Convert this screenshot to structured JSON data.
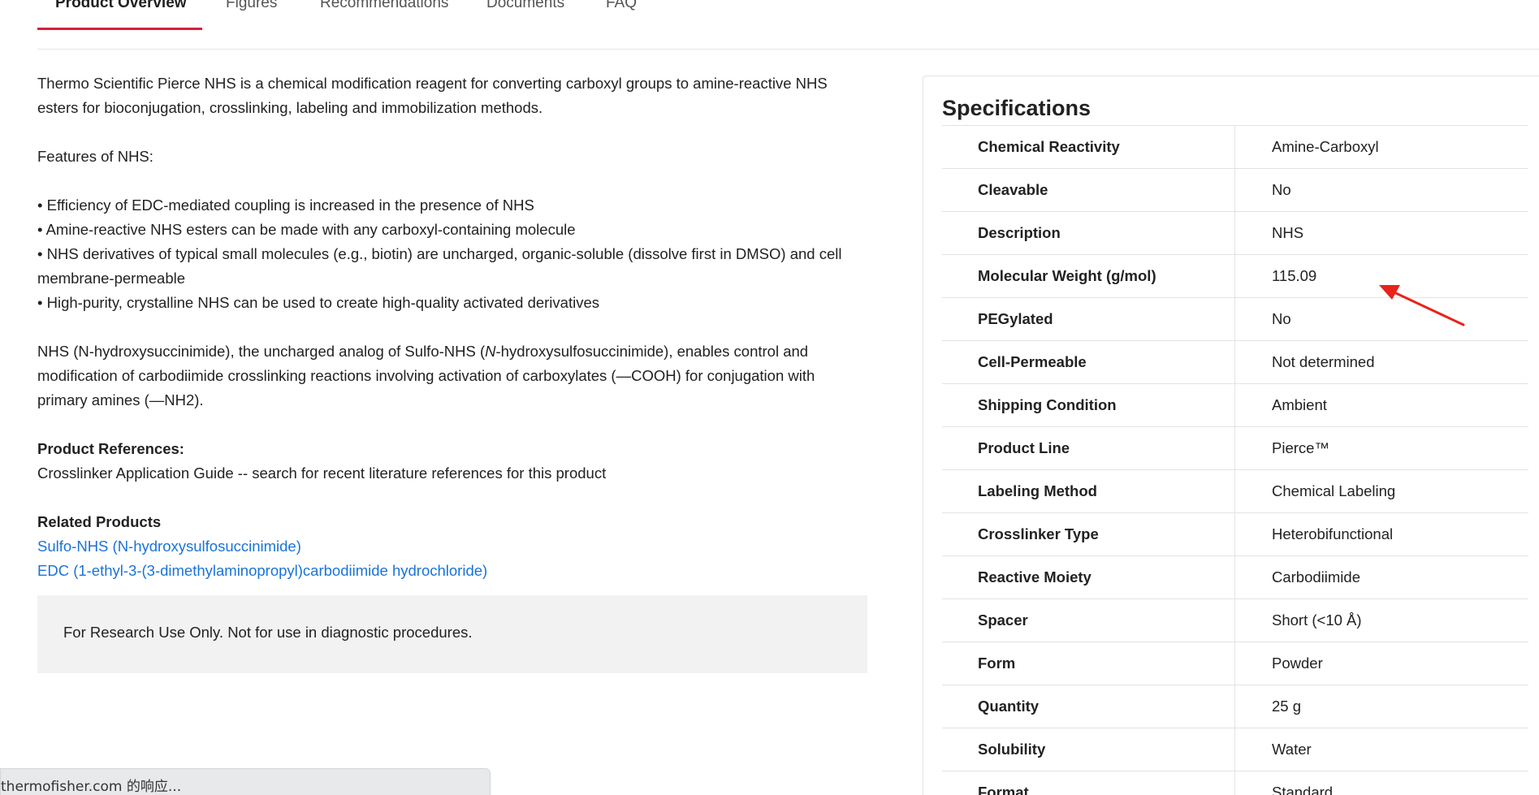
{
  "tabs": [
    {
      "label": "Product Overview",
      "active": true
    },
    {
      "label": "Figures",
      "active": false
    },
    {
      "label": "Recommendations",
      "active": false
    },
    {
      "label": "Documents",
      "active": false
    },
    {
      "label": "FAQ",
      "active": false
    }
  ],
  "overview": {
    "intro_line1": "Thermo Scientific Pierce NHS is a chemical modification reagent for converting carboxyl groups to amine-reactive NHS",
    "intro_line2": "esters for bioconjugation, crosslinking, labeling and immobilization methods.",
    "features_heading": "Features of NHS:",
    "features": [
      "• Efficiency of EDC-mediated coupling is increased in the presence of NHS",
      "• Amine-reactive NHS esters can be made with any carboxyl-containing molecule",
      "• NHS derivatives of typical small molecules (e.g., biotin) are uncharged, organic-soluble (dissolve first in DMSO) and cell",
      "membrane-permeable",
      "• High-purity, crystalline NHS can be used to create high-quality activated derivatives"
    ],
    "nhs_para": {
      "part1": "NHS (N-hydroxysuccinimide), the uncharged analog of Sulfo-NHS (",
      "italic": "N",
      "part2": "-hydroxysulfosuccinimide), enables control and",
      "line2": "modification of carbodiimide crosslinking reactions involving activation of carboxylates (—COOH) for conjugation with",
      "line3": "primary amines (—NH2)."
    },
    "references_heading": "Product References:",
    "references_text": "Crosslinker Application Guide -- search for recent literature references for this product",
    "related_heading": "Related Products",
    "related_links": [
      "Sulfo-NHS (N-hydroxysulfosuccinimide)",
      "EDC (1-ethyl-3-(3-dimethylaminopropyl)carbodiimide hydrochloride)"
    ],
    "ruo_notice": "For Research Use Only. Not for use in diagnostic procedures."
  },
  "specifications": {
    "title": "Specifications",
    "rows": [
      {
        "key": "Chemical Reactivity",
        "value": "Amine-Carboxyl"
      },
      {
        "key": "Cleavable",
        "value": "No"
      },
      {
        "key": "Description",
        "value": "NHS"
      },
      {
        "key": "Molecular Weight (g/mol)",
        "value": "115.09"
      },
      {
        "key": "PEGylated",
        "value": "No"
      },
      {
        "key": "Cell-Permeable",
        "value": "Not determined"
      },
      {
        "key": "Shipping Condition",
        "value": "Ambient"
      },
      {
        "key": "Product Line",
        "value": "Pierce™"
      },
      {
        "key": "Labeling Method",
        "value": "Chemical Labeling"
      },
      {
        "key": "Crosslinker Type",
        "value": "Heterobifunctional"
      },
      {
        "key": "Reactive Moiety",
        "value": "Carbodiimide"
      },
      {
        "key": "Spacer",
        "value": "Short (<10 Å)"
      },
      {
        "key": "Form",
        "value": "Powder"
      },
      {
        "key": "Quantity",
        "value": "25 g"
      },
      {
        "key": "Solubility",
        "value": "Water"
      },
      {
        "key": "Format",
        "value": "Standard"
      }
    ]
  },
  "status_bar": {
    "text": "thermofisher.com 的响应..."
  },
  "colors": {
    "accent_red": "#d6203a",
    "link_blue": "#1a73d9",
    "annotation_red": "#e8231c"
  }
}
